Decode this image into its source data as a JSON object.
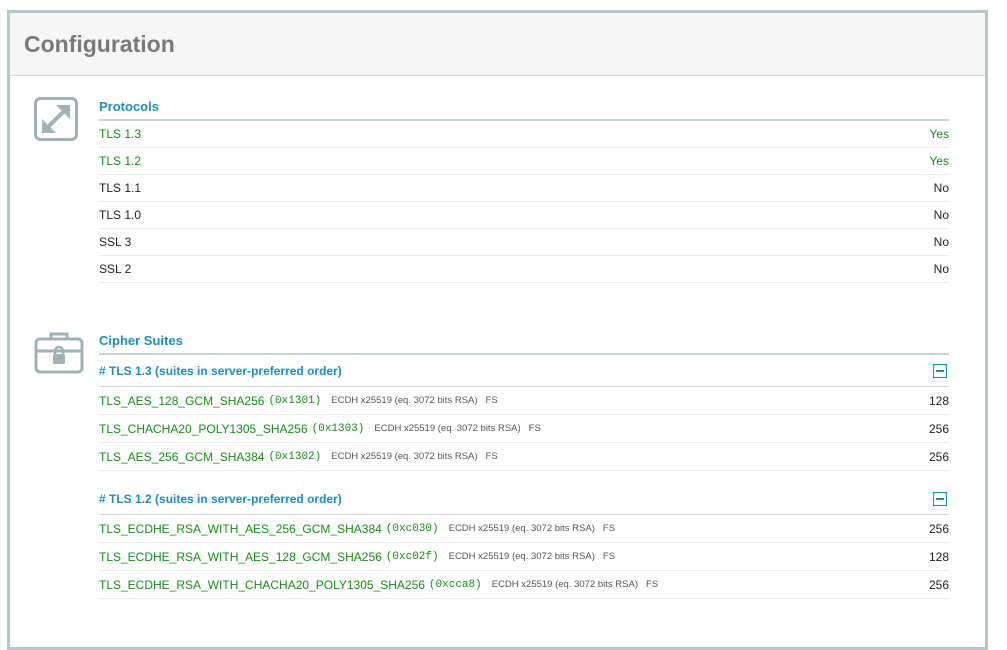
{
  "header": {
    "title": "Configuration"
  },
  "protocols": {
    "title": "Protocols",
    "rows": [
      {
        "name": "TLS 1.3",
        "value": "Yes",
        "enabled": true
      },
      {
        "name": "TLS 1.2",
        "value": "Yes",
        "enabled": true
      },
      {
        "name": "TLS 1.1",
        "value": "No",
        "enabled": false
      },
      {
        "name": "TLS 1.0",
        "value": "No",
        "enabled": false
      },
      {
        "name": "SSL 3",
        "value": "No",
        "enabled": false
      },
      {
        "name": "SSL 2",
        "value": "No",
        "enabled": false
      }
    ]
  },
  "ciphers": {
    "title": "Cipher Suites",
    "groups": [
      {
        "heading": "# TLS 1.3 (suites in server-preferred order)",
        "suites": [
          {
            "name": "TLS_AES_128_GCM_SHA256",
            "code": "(0x1301)",
            "kx": "ECDH x25519 (eq. 3072 bits RSA)",
            "fs": "FS",
            "bits": "128"
          },
          {
            "name": "TLS_CHACHA20_POLY1305_SHA256",
            "code": "(0x1303)",
            "kx": "ECDH x25519 (eq. 3072 bits RSA)",
            "fs": "FS",
            "bits": "256"
          },
          {
            "name": "TLS_AES_256_GCM_SHA384",
            "code": "(0x1302)",
            "kx": "ECDH x25519 (eq. 3072 bits RSA)",
            "fs": "FS",
            "bits": "256"
          }
        ]
      },
      {
        "heading": "# TLS 1.2 (suites in server-preferred order)",
        "suites": [
          {
            "name": "TLS_ECDHE_RSA_WITH_AES_256_GCM_SHA384",
            "code": "(0xc030)",
            "kx": "ECDH x25519 (eq. 3072 bits RSA)",
            "fs": "FS",
            "bits": "256"
          },
          {
            "name": "TLS_ECDHE_RSA_WITH_AES_128_GCM_SHA256",
            "code": "(0xc02f)",
            "kx": "ECDH x25519 (eq. 3072 bits RSA)",
            "fs": "FS",
            "bits": "128"
          },
          {
            "name": "TLS_ECDHE_RSA_WITH_CHACHA20_POLY1305_SHA256",
            "code": "(0xcca8)",
            "kx": "ECDH x25519 (eq. 3072 bits RSA)",
            "fs": "FS",
            "bits": "256"
          }
        ]
      }
    ]
  },
  "icons": {
    "protocols": "expand-arrows-icon",
    "ciphers": "toolbox-lock-icon",
    "collapse": "minus-square-icon"
  },
  "colors": {
    "accent": "#1a8fbf",
    "enabled": "#138f13",
    "border": "#b5c7c9"
  }
}
